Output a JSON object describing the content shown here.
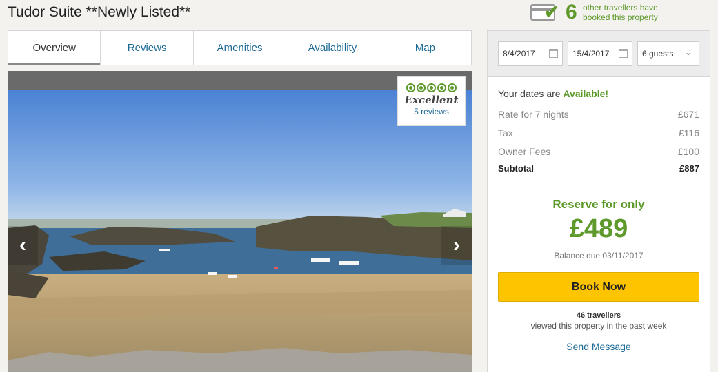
{
  "listing": {
    "title": "Tudor Suite **Newly Listed**"
  },
  "booked": {
    "count": "6",
    "text_line1": "other travellers have",
    "text_line2": "booked this property"
  },
  "tabs": [
    {
      "label": "Overview"
    },
    {
      "label": "Reviews"
    },
    {
      "label": "Amenities"
    },
    {
      "label": "Availability"
    },
    {
      "label": "Map"
    }
  ],
  "gallery": {
    "prev_icon": "chevron-left-icon",
    "next_icon": "chevron-right-icon",
    "rating_word": "Excellent",
    "review_count": "5 reviews",
    "rating_bubbles": 5
  },
  "booking": {
    "checkin": "8/4/2017",
    "checkout": "15/4/2017",
    "guests": "6 guests",
    "availability_prefix": "Your dates are",
    "availability_status": "Available!",
    "rows": [
      {
        "label": "Rate for 7 nights",
        "value": "£671"
      },
      {
        "label": "Tax",
        "value": "£116"
      },
      {
        "label": "Owner Fees",
        "value": "£100"
      }
    ],
    "subtotal_label": "Subtotal",
    "subtotal_value": "£887",
    "reserve_label": "Reserve for only",
    "reserve_amount": "£489",
    "balance_due": "Balance due 03/11/2017",
    "book_button": "Book Now",
    "viewed_count": "46 travellers",
    "viewed_text": "viewed this property in the past week",
    "send_message": "Send Message"
  },
  "colors": {
    "accent_green": "#5e9a2b",
    "link_blue": "#1d6a97",
    "book_yellow": "#ffc400"
  }
}
